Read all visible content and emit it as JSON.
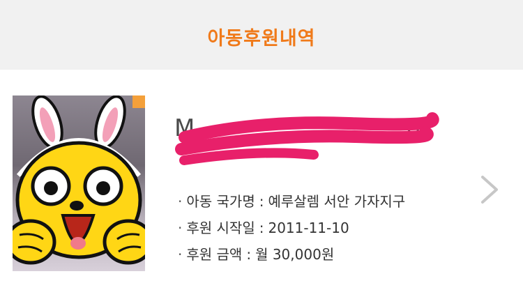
{
  "header": {
    "title": "아동후원내역"
  },
  "child": {
    "name_visible": "M",
    "name_end": "n",
    "details": [
      {
        "label": "아동 국가명",
        "value": "예루살렘 서안 가자지구"
      },
      {
        "label": "후원 시작일",
        "value": "2011-11-10"
      },
      {
        "label": "후원 금액",
        "value": "월 30,000원"
      }
    ]
  },
  "icons": {
    "avatar": "yellow-rabbit-character-icon",
    "chevron": "chevron-right-icon",
    "redaction": "pink-scribble"
  },
  "colors": {
    "accent": "#f07a1a",
    "header_bg": "#f1f1f1",
    "redaction": "#e8206a"
  }
}
